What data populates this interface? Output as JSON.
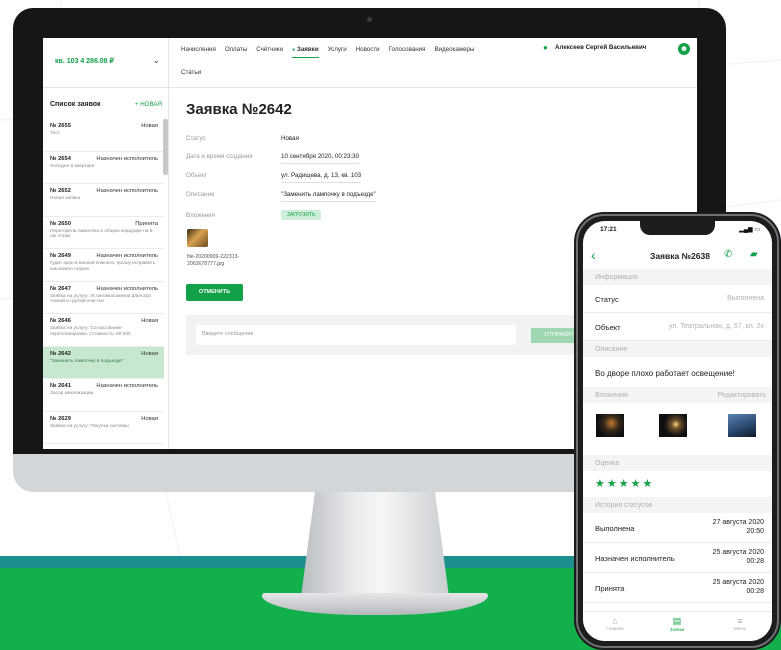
{
  "colors": {
    "accent": "#12a048",
    "band_teal": "#1e8f8f",
    "band_green": "#12b04b"
  },
  "desktop": {
    "account": "кв. 103 4 286.08 ₽",
    "nav": [
      "Начисления",
      "Оплаты",
      "Счётчики",
      "Заявки",
      "Услуги",
      "Новости",
      "Голосования",
      "Видеокамеры"
    ],
    "nav_active": "Заявки",
    "nav_second_row": "Статьи",
    "user_name": "Алексеев Сергей Васильевич",
    "sidebar": {
      "heading": "Список заявок",
      "new_label": "+ НОВАЯ",
      "requests": [
        {
          "num": "№ 2655",
          "status": "Новая",
          "desc": "Тест"
        },
        {
          "num": "№ 2654",
          "status": "Назначен исполнитель",
          "desc": "Холодно в квартире"
        },
        {
          "num": "№ 2652",
          "status": "Назначен исполнитель",
          "desc": "Новая заявка"
        },
        {
          "num": "№ 2650",
          "status": "Принята",
          "desc": "Перегорела лампочка в общем коридоре на 5-ом этаже"
        },
        {
          "num": "№ 2649",
          "status": "Назначен исполнитель",
          "desc": "Гудит кран в ванной комнате, прошу исправить как можно скорее"
        },
        {
          "num": "№ 2647",
          "status": "Назначен исполнитель",
          "desc": "Заявка на услугу: Установка/замена фильтра тонкой и грубой очистки"
        },
        {
          "num": "№ 2646",
          "status": "Новая",
          "desc": "Заявка на услугу: Согласование перепланировки. Стоимость: 59 000"
        },
        {
          "num": "№ 2642",
          "status": "Новая",
          "desc": "\"Заменить лампочку в подъезде\""
        },
        {
          "num": "№ 2641",
          "status": "Назначен исполнитель",
          "desc": "Засор канализации"
        },
        {
          "num": "№ 2629",
          "status": "Новая",
          "desc": "Заявка на услугу: Покупка системы"
        }
      ]
    },
    "main": {
      "title": "Заявка №2642",
      "fields": [
        {
          "label": "Статус",
          "value": "Новая"
        },
        {
          "label": "Дата и время создания",
          "value": "10 сентября 2020, 00:23:30"
        },
        {
          "label": "Объект",
          "value": "ул. Радищева, д. 13, кв. 103"
        },
        {
          "label": "Описание",
          "value": "\"Заменить лампочку в подъезде\""
        }
      ],
      "attachments_label": "Вложения",
      "upload_label": "ЗАГРУЗИТЬ",
      "file_name": "file-20200909-222313-2063678777.jpg",
      "cancel_label": "ОТМЕНИТЬ",
      "message_placeholder": "Введите сообщение",
      "send_label": "ОТПРАВИТЬ"
    }
  },
  "phone": {
    "time": "17:21",
    "title": "Заявка №2638",
    "section_info": "Информация",
    "status_label": "Статус",
    "status_value": "Выполнена",
    "object_label": "Объект",
    "object_value": "ул. Театральная, д. 57, кл. 2х",
    "section_desc": "Описание",
    "description": "Во дворе плохо работает освещение!",
    "section_attach": "Вложения",
    "edit_label": "Редактировать",
    "section_rating": "Оценка",
    "rating": 5,
    "stars": "★★★★★",
    "section_history": "История статусов",
    "history": [
      {
        "status": "Выполнена",
        "date": "27 августа 2020",
        "time": "20:50"
      },
      {
        "status": "Назначен исполнитель",
        "date": "25 августа 2020",
        "time": "00:28"
      },
      {
        "status": "Принята",
        "date": "25 августа 2020",
        "time": "00:28"
      }
    ],
    "tabs": [
      "Главная",
      "Заявки",
      "Меню"
    ],
    "tab_active": "Заявки"
  }
}
